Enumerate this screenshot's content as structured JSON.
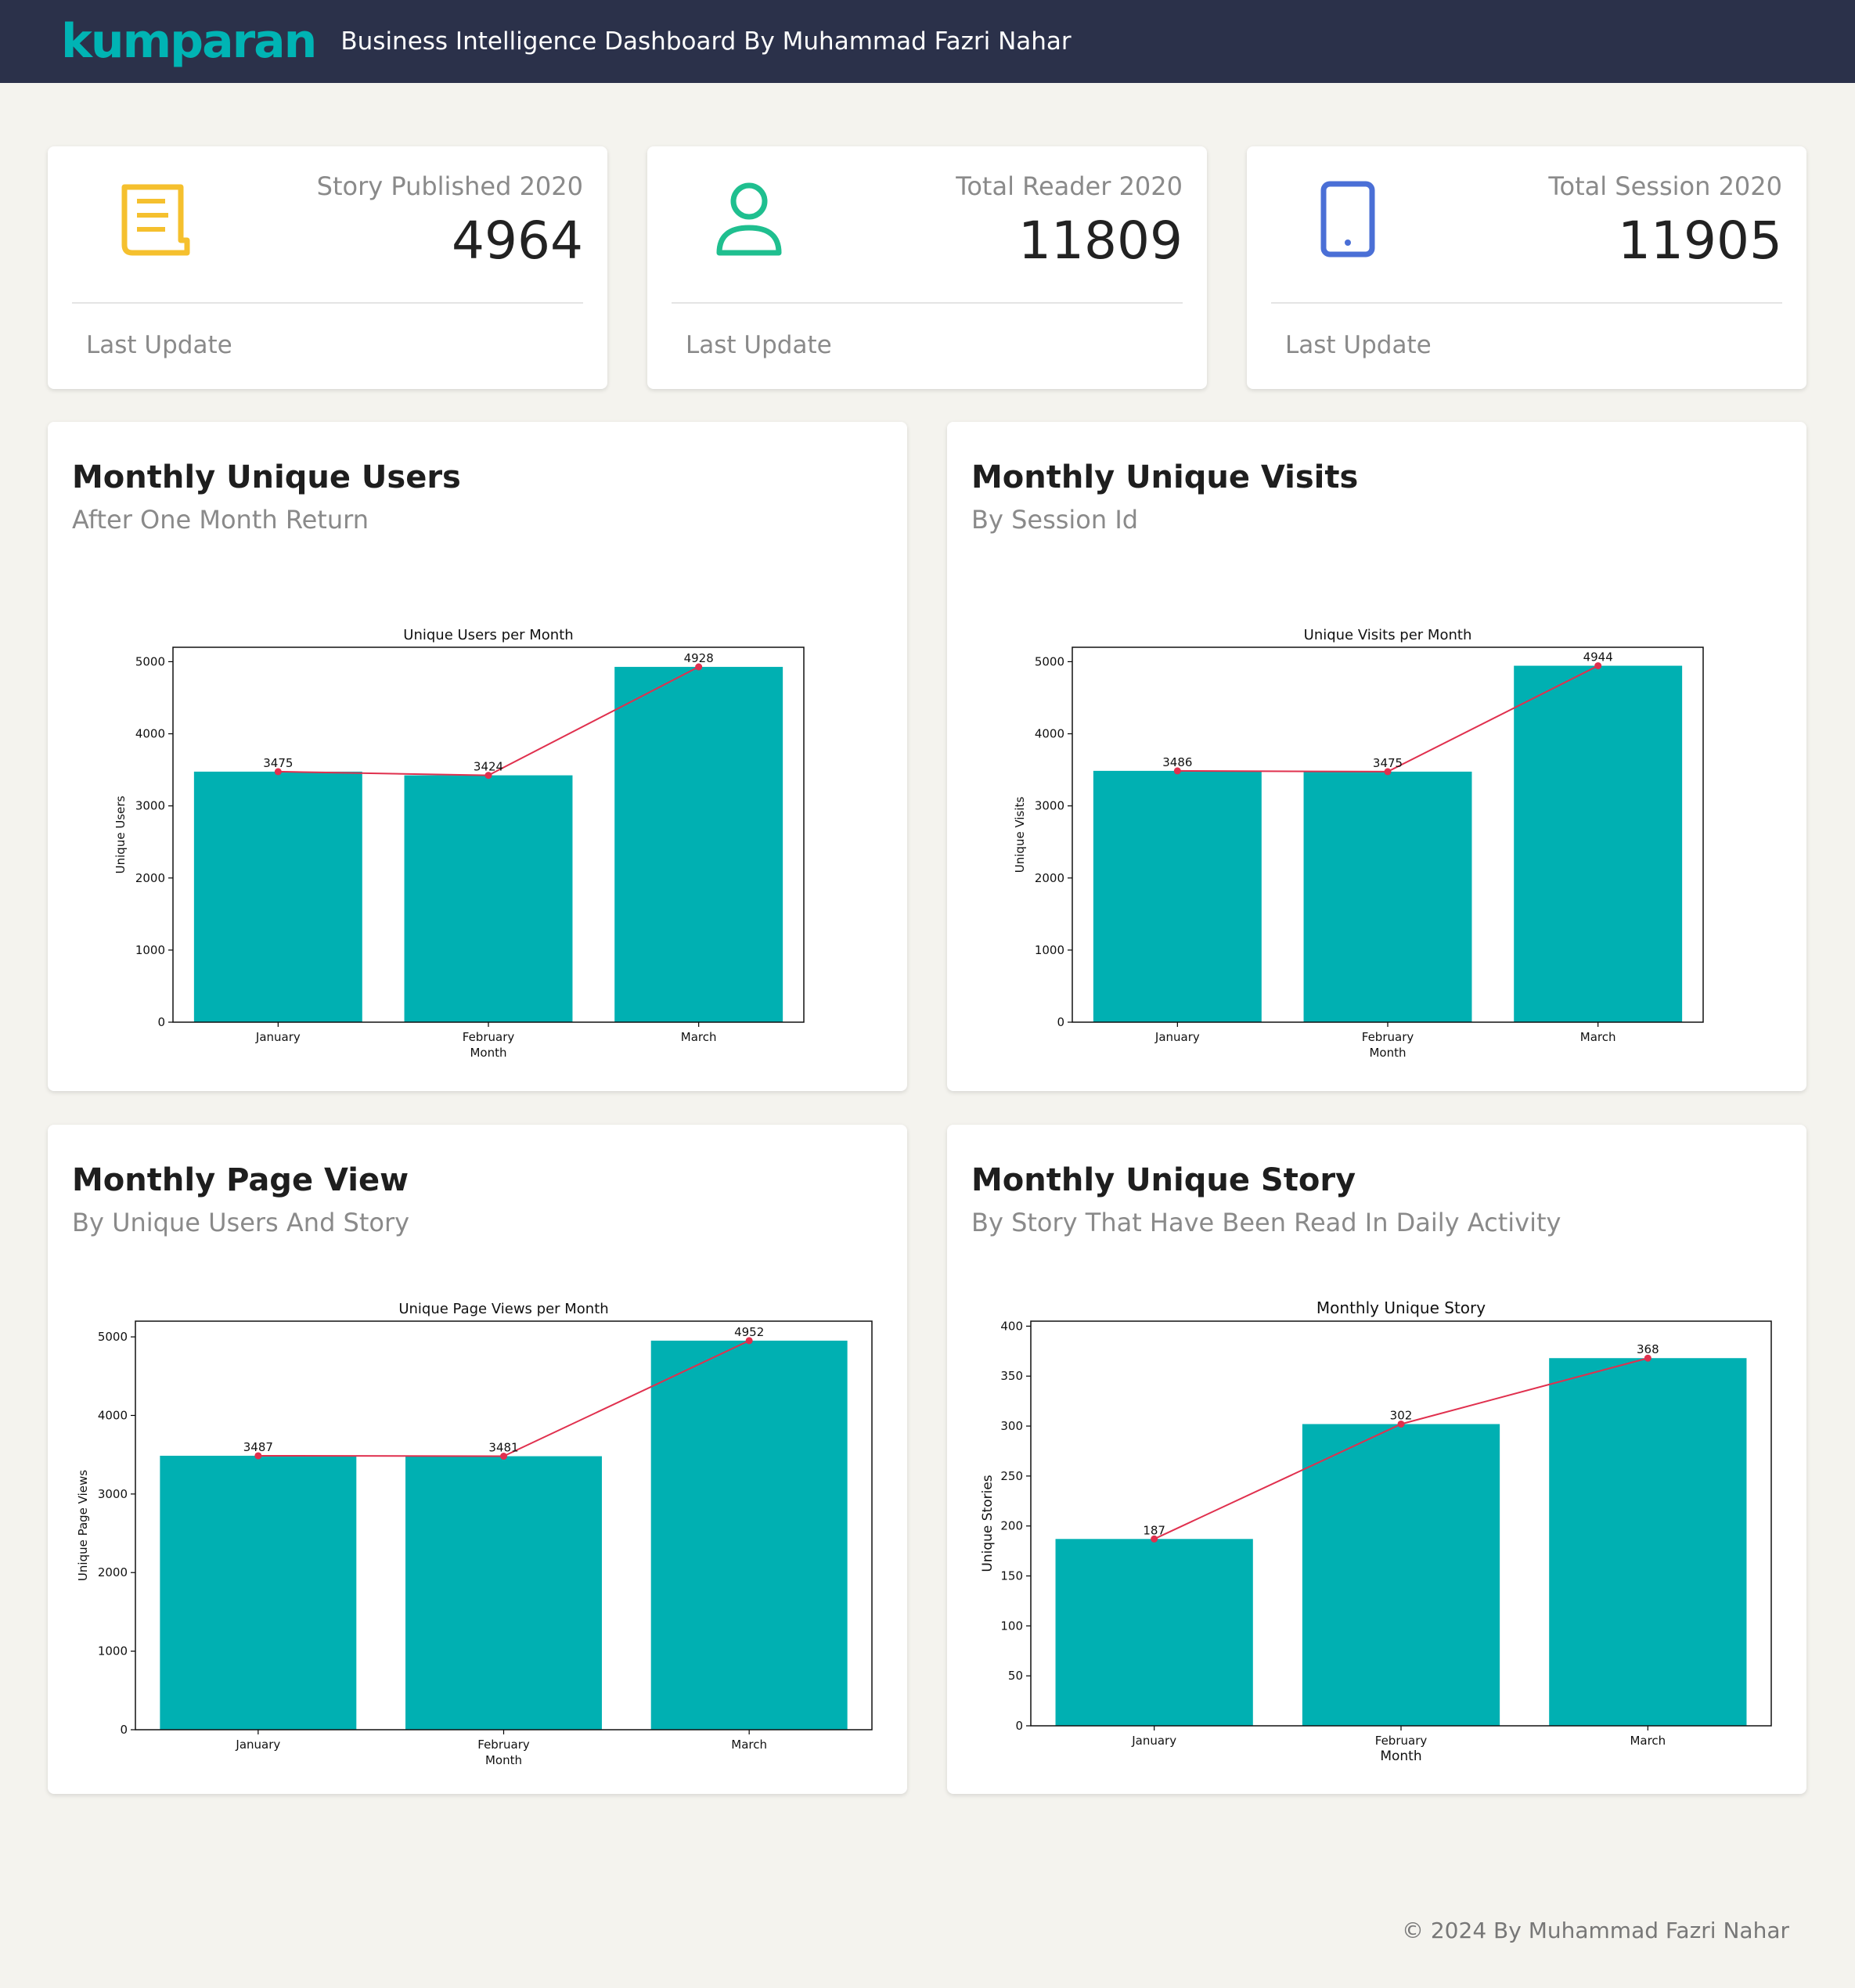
{
  "navbar": {
    "logo": "kumparan",
    "title": "Business Intelligence Dashboard By Muhammad Fazri Nahar"
  },
  "stats": [
    {
      "label": "Story Published 2020",
      "value": "4964",
      "footer": "Last Update",
      "icon": "document-icon",
      "color": "#f5c02e"
    },
    {
      "label": "Total Reader 2020",
      "value": "11809",
      "footer": "Last Update",
      "icon": "user-icon",
      "color": "#1fbf8f"
    },
    {
      "label": "Total Session 2020",
      "value": "11905",
      "footer": "Last Update",
      "icon": "tablet-icon",
      "color": "#4a6fd6"
    }
  ],
  "charts": [
    {
      "title": "Monthly Unique Users",
      "subtitle": "After One Month Return"
    },
    {
      "title": "Monthly Unique Visits",
      "subtitle": "By Session Id"
    },
    {
      "title": "Monthly Page View",
      "subtitle": "By Unique Users And Story"
    },
    {
      "title": "Monthly Unique Story",
      "subtitle": "By Story That Have Been Read In Daily Activity"
    }
  ],
  "chart_data": [
    {
      "type": "bar",
      "title": "Unique Users per Month",
      "xlabel": "Month",
      "ylabel": "Unique Users",
      "categories": [
        "January",
        "February",
        "March"
      ],
      "values": [
        3475,
        3424,
        4928
      ],
      "ylim": [
        0,
        5200
      ],
      "yticks": [
        0,
        1000,
        2000,
        3000,
        4000,
        5000
      ],
      "bar_color": "#00b0b2",
      "line_color": "#e0304e"
    },
    {
      "type": "bar",
      "title": "Unique Visits per Month",
      "xlabel": "Month",
      "ylabel": "Unique Visits",
      "categories": [
        "January",
        "February",
        "March"
      ],
      "values": [
        3486,
        3475,
        4944
      ],
      "ylim": [
        0,
        5200
      ],
      "yticks": [
        0,
        1000,
        2000,
        3000,
        4000,
        5000
      ],
      "bar_color": "#00b0b2",
      "line_color": "#e0304e"
    },
    {
      "type": "bar",
      "title": "Unique Page Views per Month",
      "xlabel": "Month",
      "ylabel": "Unique Page Views",
      "categories": [
        "January",
        "February",
        "March"
      ],
      "values": [
        3487,
        3481,
        4952
      ],
      "ylim": [
        0,
        5200
      ],
      "yticks": [
        0,
        1000,
        2000,
        3000,
        4000,
        5000
      ],
      "bar_color": "#00b0b2",
      "line_color": "#e0304e"
    },
    {
      "type": "bar",
      "title": "Monthly Unique Story",
      "xlabel": "Month",
      "ylabel": "Unique Stories",
      "categories": [
        "January",
        "February",
        "March"
      ],
      "values": [
        187,
        302,
        368
      ],
      "ylim": [
        0,
        405
      ],
      "yticks": [
        0,
        50,
        100,
        150,
        200,
        250,
        300,
        350,
        400
      ],
      "bar_color": "#00b0b2",
      "line_color": "#e0304e"
    }
  ],
  "footer": "© 2024 By Muhammad Fazri Nahar"
}
